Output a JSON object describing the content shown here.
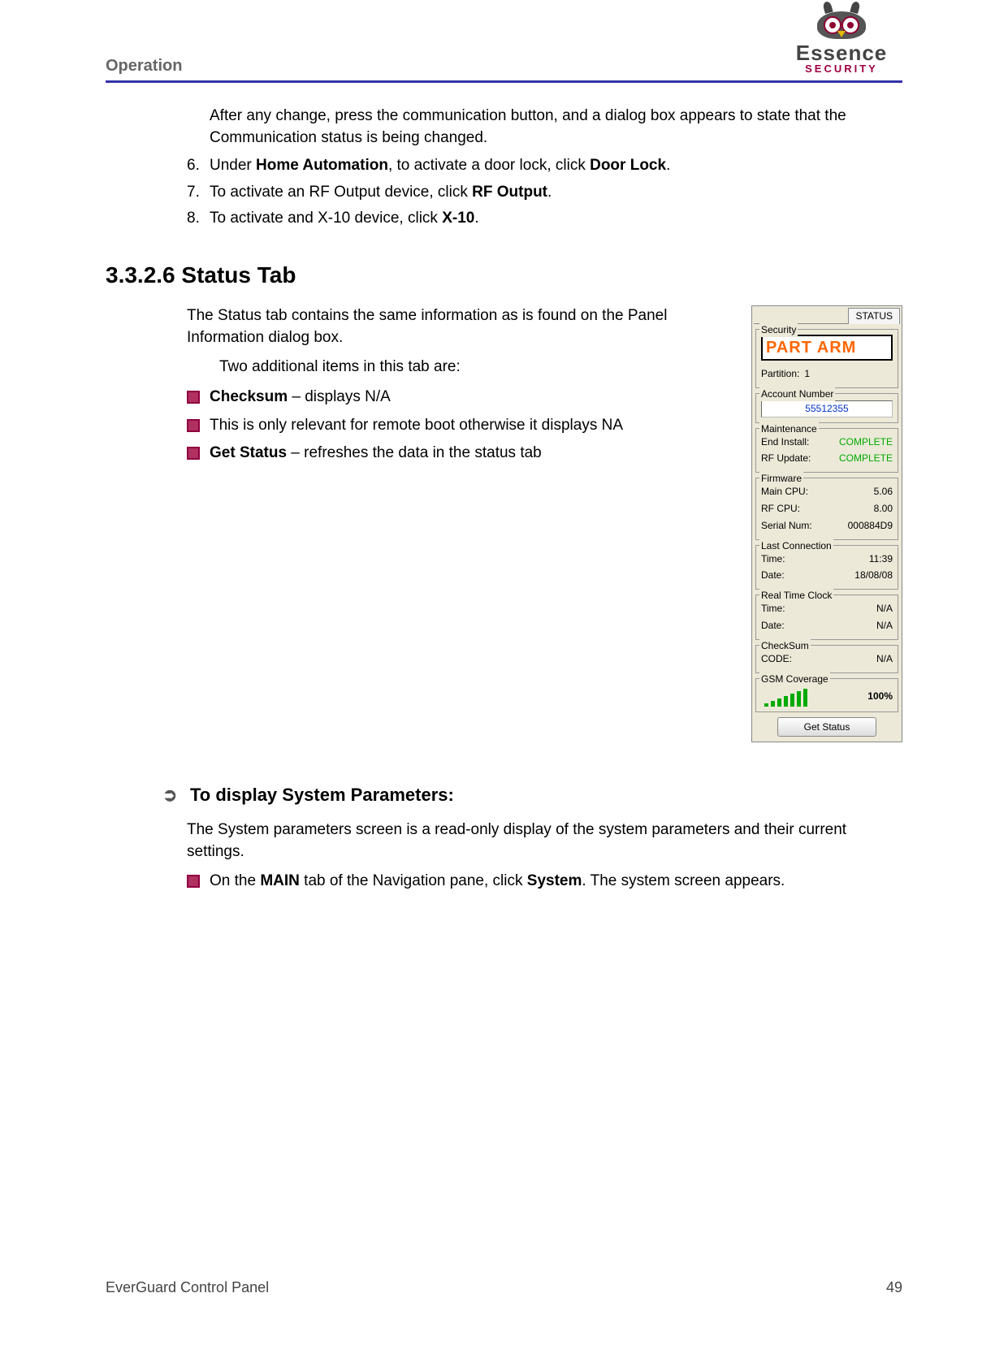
{
  "header": {
    "title": "Operation"
  },
  "logo": {
    "brand": "Essence",
    "tagline": "SECURITY"
  },
  "intro_para": "After any change, press the communication button, and a dialog box appears to state that the Communication status is being changed.",
  "steps": [
    {
      "n": "6.",
      "pre": "Under ",
      "b1": "Home Automation",
      "mid": ", to activate a door lock, click ",
      "b2": "Door Lock",
      "post": "."
    },
    {
      "n": "7.",
      "pre": " To activate an RF Output device, click ",
      "b1": "RF Output",
      "mid": "",
      "b2": "",
      "post": "."
    },
    {
      "n": "8.",
      "pre": " To activate and X-10 device, click ",
      "b1": "X-10",
      "mid": "",
      "b2": "",
      "post": "."
    }
  ],
  "heading": "3.3.2.6    Status Tab",
  "status_intro": "The Status tab contains the same information as is found on the Panel Information dialog box.",
  "status_sub": "Two additional items in this tab are:",
  "bullets": [
    {
      "b": "Checksum",
      "rest": " – displays N/A"
    },
    {
      "b": "",
      "rest": "This is only relevant for remote boot otherwise it displays NA"
    },
    {
      "b": "Get Status",
      "rest": " – refreshes the data in the status tab"
    }
  ],
  "panel": {
    "tab": "STATUS",
    "security": {
      "label": "Security",
      "status": "PART ARM",
      "partition_label": "Partition:",
      "partition_value": "1"
    },
    "account": {
      "label": "Account Number",
      "value": "55512355"
    },
    "maintenance": {
      "label": "Maintenance",
      "end_install_label": "End Install:",
      "end_install_value": "COMPLETE",
      "rf_label": "RF Update:",
      "rf_value": "COMPLETE"
    },
    "firmware": {
      "label": "Firmware",
      "main_label": "Main CPU:",
      "main_value": "5.06",
      "rf_label": "RF CPU:",
      "rf_value": "8.00",
      "serial_label": "Serial Num:",
      "serial_value": "000884D9"
    },
    "last_conn": {
      "label": "Last Connection",
      "time_label": "Time:",
      "time_value": "11:39",
      "date_label": "Date:",
      "date_value": "18/08/08"
    },
    "rtc": {
      "label": "Real Time Clock",
      "time_label": "Time:",
      "time_value": "N/A",
      "date_label": "Date:",
      "date_value": "N/A"
    },
    "checksum": {
      "label": "CheckSum",
      "code_label": "CODE:",
      "code_value": "N/A"
    },
    "gsm": {
      "label": "GSM Coverage",
      "pct": "100%"
    },
    "button": "Get Status"
  },
  "sys_heading": "To display System Parameters:",
  "sys_para": "The System parameters screen is a read-only display of the system parameters and their current settings.",
  "sys_bullet": {
    "pre": "On the ",
    "b1": "MAIN",
    "mid": " tab of the Navigation pane, click ",
    "b2": "System",
    "post": ". The system screen appears."
  },
  "footer": {
    "left": "EverGuard Control Panel",
    "right": "49"
  }
}
